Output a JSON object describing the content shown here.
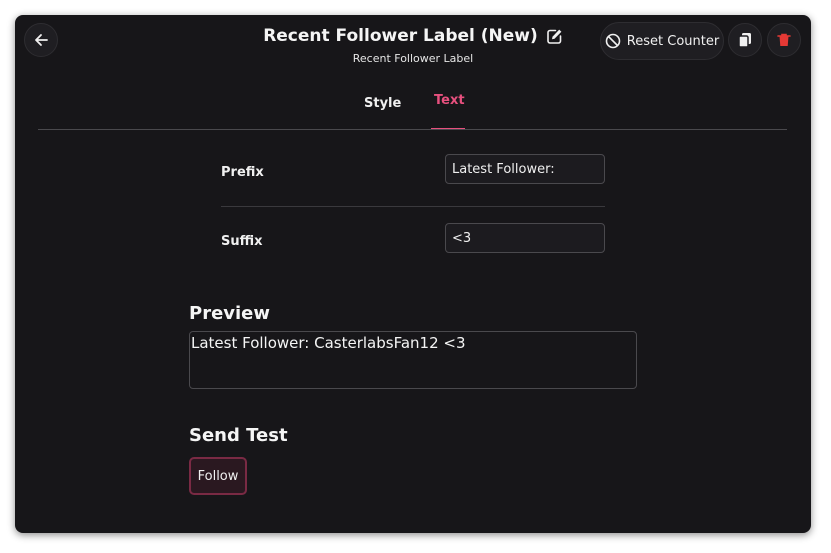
{
  "header": {
    "title": "Recent Follower Label (New)",
    "subtitle": "Recent Follower Label",
    "reset_label": "Reset Counter"
  },
  "tabs": [
    {
      "label": "Style",
      "active": false
    },
    {
      "label": "Text",
      "active": true
    }
  ],
  "fields": {
    "prefix": {
      "label": "Prefix",
      "value": "Latest Follower:"
    },
    "suffix": {
      "label": "Suffix",
      "value": "<3"
    }
  },
  "preview": {
    "title": "Preview",
    "text": "Latest Follower: CasterlabsFan12 <3"
  },
  "send_test": {
    "title": "Send Test",
    "button_label": "Follow"
  },
  "colors": {
    "accent": "#e7507e",
    "delete": "#e53935",
    "background": "#171619"
  },
  "icons": [
    "back-arrow-icon",
    "edit-icon",
    "prohibited-icon",
    "copy-icon",
    "trash-icon"
  ]
}
